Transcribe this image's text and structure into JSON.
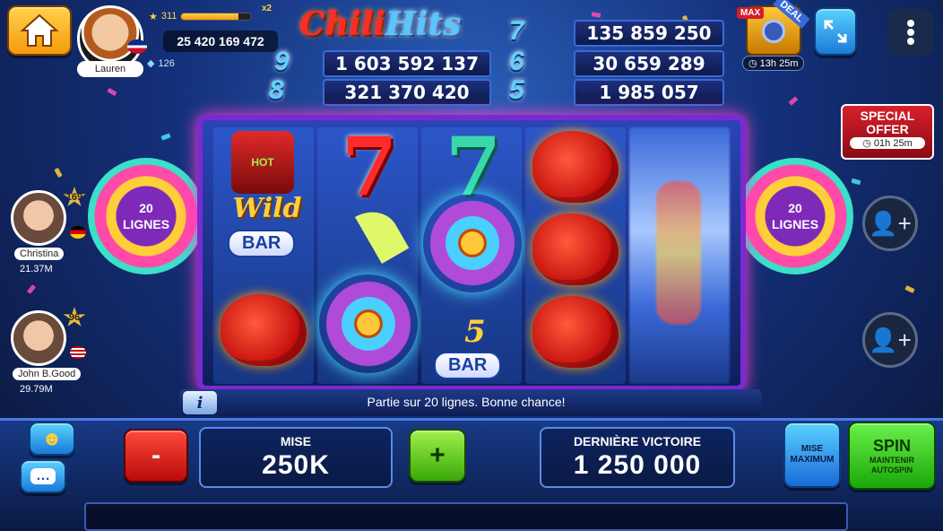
{
  "player": {
    "name": "Lauren",
    "level": "311",
    "xp_progress": 0.82,
    "xp_badge": "x2",
    "coins": "25 420 169 472",
    "gems": "126"
  },
  "logo": {
    "part1": "Chili",
    "part2": "Hits"
  },
  "jackpots": {
    "left": [
      {
        "number": "9",
        "value": "1 603 592 137"
      },
      {
        "number": "8",
        "value": "321 370 420"
      }
    ],
    "right": [
      {
        "number": "7",
        "value": "135 859 250"
      },
      {
        "number": "6",
        "value": "30 659 289"
      },
      {
        "number": "5",
        "value": "1 985 057"
      }
    ]
  },
  "deal": {
    "tag": "MAX",
    "ribbon": "DEAL",
    "timer": "13h 25m"
  },
  "special_offer": {
    "line1": "SPECIAL",
    "line2": "OFFER",
    "timer": "01h 25m"
  },
  "lines_left": "20\nLIGNES",
  "lines_right": "20\nLIGNES",
  "reels": {
    "wild_label": "Wild",
    "hot_label": "HOT",
    "bar_label": "BAR",
    "bar5_number": "5",
    "bar5_label": "BAR",
    "seven": "7"
  },
  "players": [
    {
      "name": "Christina",
      "level": "169",
      "coins": "21.37M"
    },
    {
      "name": "John B.Good",
      "level": "96",
      "coins": "29.79M"
    }
  ],
  "info": {
    "icon": "i",
    "text": "Partie sur 20 lignes. Bonne chance!"
  },
  "bet": {
    "label": "MISE",
    "value": "250K",
    "minus": "-",
    "plus": "+"
  },
  "last_win": {
    "label": "DERNIÈRE VICTOIRE",
    "value": "1 250 000"
  },
  "max_bet": {
    "line1": "MISE",
    "line2": "MAXIMUM"
  },
  "spin": {
    "label": "SPIN",
    "sub1": "MAINTENIR",
    "sub2": "AUTOSPIN"
  },
  "colors": {
    "accent": "#5ad2ff",
    "spin": "#3ad80a",
    "minus": "#e01a1a",
    "frame": "#7b2ad0"
  }
}
